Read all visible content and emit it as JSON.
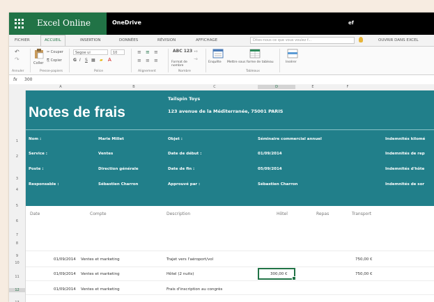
{
  "app": {
    "name": "Excel Online",
    "service": "OneDrive",
    "user": "ef"
  },
  "tabs": [
    "FICHIER",
    "ACCUEIL",
    "INSERTION",
    "DONNÉES",
    "RÉVISION",
    "AFFICHAGE"
  ],
  "tellme": {
    "placeholder": "Dites-nous ce que vous voulez f..."
  },
  "open_in_excel": "OUVRIR DANS EXCEL",
  "ribbon": {
    "undo_label": "Annuler",
    "paste_label": "Coller",
    "cut_label": "Couper",
    "copy_label": "Copier",
    "font_name": "Segoe ui",
    "font_size": "10",
    "number_format_label": "Format de nombre",
    "abc_label": "ABC 123",
    "table_label": "Enquête",
    "format_table_label": "Mettre sous forme de tableau",
    "insert_label": "Insérer",
    "groups": [
      "Annuler",
      "Presse-papiers",
      "Police",
      "Alignement",
      "Nombre",
      "Tableaux"
    ]
  },
  "formula_bar": {
    "fx": "fx",
    "value": "300"
  },
  "columns": [
    "A",
    "B",
    "C",
    "D",
    "E",
    "F"
  ],
  "rows": [
    "1",
    "2",
    "3",
    "4",
    "5",
    "6",
    "7",
    "8",
    "9",
    "10",
    "11",
    "12",
    "13"
  ],
  "sheet": {
    "title": "Notes de frais",
    "company": "Tailspin Toys",
    "address": "123 avenue de la Méditerranée, 75001 PARIS",
    "info_rows": [
      {
        "label": "Nom :",
        "value": "Marie Millet",
        "label2": "Objet :",
        "value2": "Séminaire commercial annuel",
        "extra": "Indemnités kilomé"
      },
      {
        "label": "Service :",
        "value": "Ventes",
        "label2": "Date de début :",
        "value2": "01/09/2014",
        "extra": "Indemnités de rep"
      },
      {
        "label": "Poste :",
        "value": "Direction générale",
        "label2": "Date de fin :",
        "value2": "05/09/2014",
        "extra": "Indemnités d'hôte"
      },
      {
        "label": "Responsable :",
        "value": "Sébastien Charron",
        "label2": "Approuvé par :",
        "value2": "Sébastien Charron",
        "extra": "Indemnités de sor"
      }
    ],
    "headers": [
      "Date",
      "Compte",
      "Description",
      "Hôtel",
      "Repas",
      "Transport"
    ],
    "rows": [
      {
        "date": "01/09/2014",
        "account": "Ventes et marketing",
        "desc": "Trajet vers l'aéroport/vol",
        "hotel": "",
        "meals": "",
        "transport": "750,00 €"
      },
      {
        "date": "01/09/2014",
        "account": "Ventes et marketing",
        "desc": "Hôtel (2 nuits)",
        "hotel": "300,00 €",
        "meals": "",
        "transport": "750,00 €"
      },
      {
        "date": "01/09/2014",
        "account": "Ventes et marketing",
        "desc": "Frais d'inscription au congrès",
        "hotel": "",
        "meals": "",
        "transport": ""
      }
    ]
  },
  "colors": {
    "excel_green": "#217346",
    "banner_teal": "#217f8a"
  }
}
